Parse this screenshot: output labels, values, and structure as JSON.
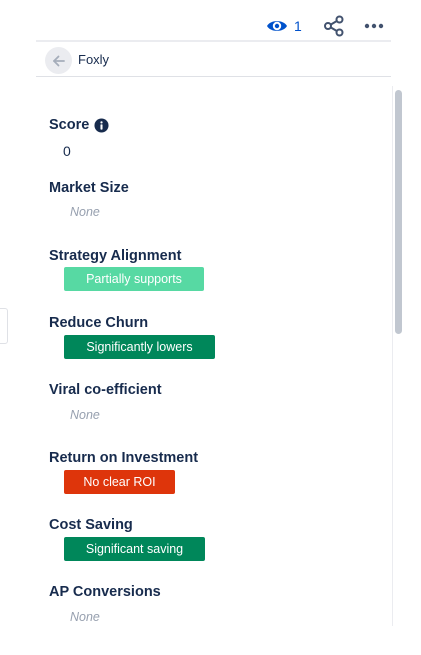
{
  "toolbar": {
    "watch_count": "1",
    "icons": {
      "watch": "eye-icon",
      "share": "share-icon",
      "more": "more-icon"
    },
    "accent_color": "#0052cc"
  },
  "breadcrumb": {
    "back_icon": "arrow-left-icon",
    "title": "Foxly"
  },
  "fields": {
    "score": {
      "label": "Score",
      "value": "0",
      "info_icon": "info-icon"
    },
    "market_size": {
      "label": "Market Size",
      "value": "None"
    },
    "strategy_alignment": {
      "label": "Strategy Alignment",
      "value": "Partially supports",
      "color": "#57d9a3"
    },
    "reduce_churn": {
      "label": "Reduce Churn",
      "value": "Significantly lowers",
      "color": "#00875a"
    },
    "viral_coefficient": {
      "label": "Viral co-efficient",
      "value": "None"
    },
    "roi": {
      "label": "Return on Investment",
      "value": "No clear ROI",
      "color": "#de350b"
    },
    "cost_saving": {
      "label": "Cost Saving",
      "value": "Significant saving",
      "color": "#00875a"
    },
    "ap_conversions": {
      "label": "AP Conversions",
      "value": "None"
    }
  }
}
